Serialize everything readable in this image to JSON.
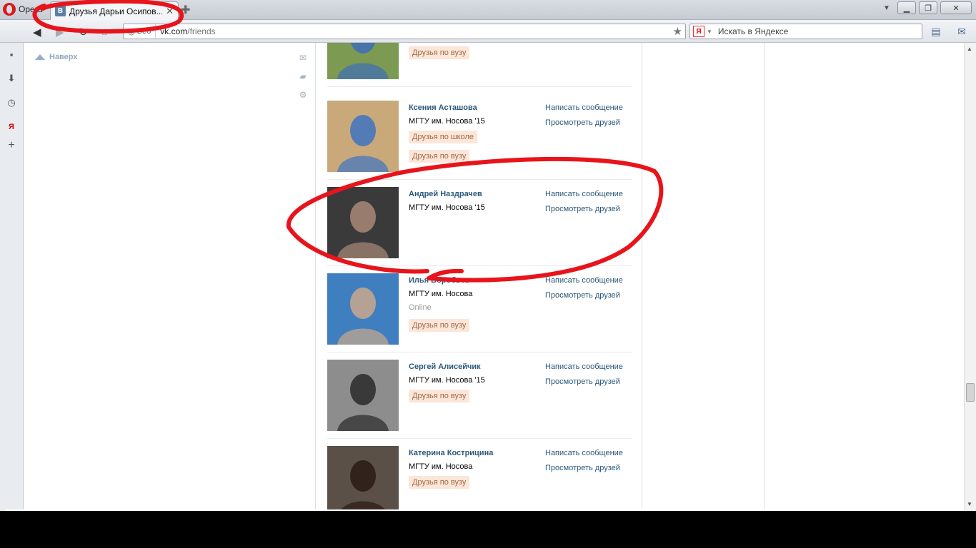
{
  "browser": {
    "menu_label": "Opera",
    "tab_title": "Друзья Дарьи Осипов...",
    "tab_favicon": "B",
    "address_badge": "Веб",
    "address_domain": "vk.com",
    "address_path": "/friends",
    "search_placeholder": "Искать в Яндексе",
    "search_engine_icon": "Я"
  },
  "sidebar": {
    "to_top_label": "Наверх"
  },
  "friends": [
    {
      "name": "",
      "university": "",
      "status": "",
      "tags": [
        "Друзья по вузу"
      ],
      "actions": [],
      "photo": {
        "bg": "#7c9a52",
        "fg": "#3f6fb8"
      }
    },
    {
      "name": "Ксения Асташова",
      "university": "МГТУ им. Носова '15",
      "status": "",
      "tags": [
        "Друзья по школе",
        "Друзья по вузу"
      ],
      "actions": [
        "Написать сообщение",
        "Просмотреть друзей"
      ],
      "photo": {
        "bg": "#c9a97a",
        "fg": "#3e74c2"
      }
    },
    {
      "name": "Андрей Наздрачев",
      "university": "МГТУ им. Носова '15",
      "status": "",
      "tags": [],
      "actions": [
        "Написать сообщение",
        "Просмотреть друзей"
      ],
      "photo": {
        "bg": "#3a3a3a",
        "fg": "#a98a78"
      }
    },
    {
      "name": "Илья Воробьев",
      "university": "МГТУ им. Носова",
      "status": "Online",
      "tags": [
        "Друзья по вузу"
      ],
      "actions": [
        "Написать сообщение",
        "Просмотреть друзей"
      ],
      "photo": {
        "bg": "#3f7fbf",
        "fg": "#caa88d"
      }
    },
    {
      "name": "Сергей Алисейчик",
      "university": "МГТУ им. Носова '15",
      "status": "",
      "tags": [
        "Друзья по вузу"
      ],
      "actions": [
        "Написать сообщение",
        "Просмотреть друзей"
      ],
      "photo": {
        "bg": "#8d8d8d",
        "fg": "#2a2a2a"
      }
    },
    {
      "name": "Катерина Кострицина",
      "university": "МГТУ им. Носова",
      "status": "",
      "tags": [
        "Друзья по вузу"
      ],
      "actions": [
        "Написать сообщение",
        "Просмотреть друзей"
      ],
      "photo": {
        "bg": "#5a5048",
        "fg": "#2a1a14"
      }
    }
  ],
  "colors": {
    "link": "#2b587a",
    "tag_bg": "#fbe6d9",
    "tag_text": "#a36a45",
    "annotation": "#e8141b"
  },
  "icons": {
    "back": "back-arrow-icon",
    "forward": "forward-arrow-icon",
    "reload": "reload-icon",
    "star": "star-icon",
    "message": "envelope-icon",
    "comment": "comment-icon",
    "settings": "gear-icon"
  }
}
